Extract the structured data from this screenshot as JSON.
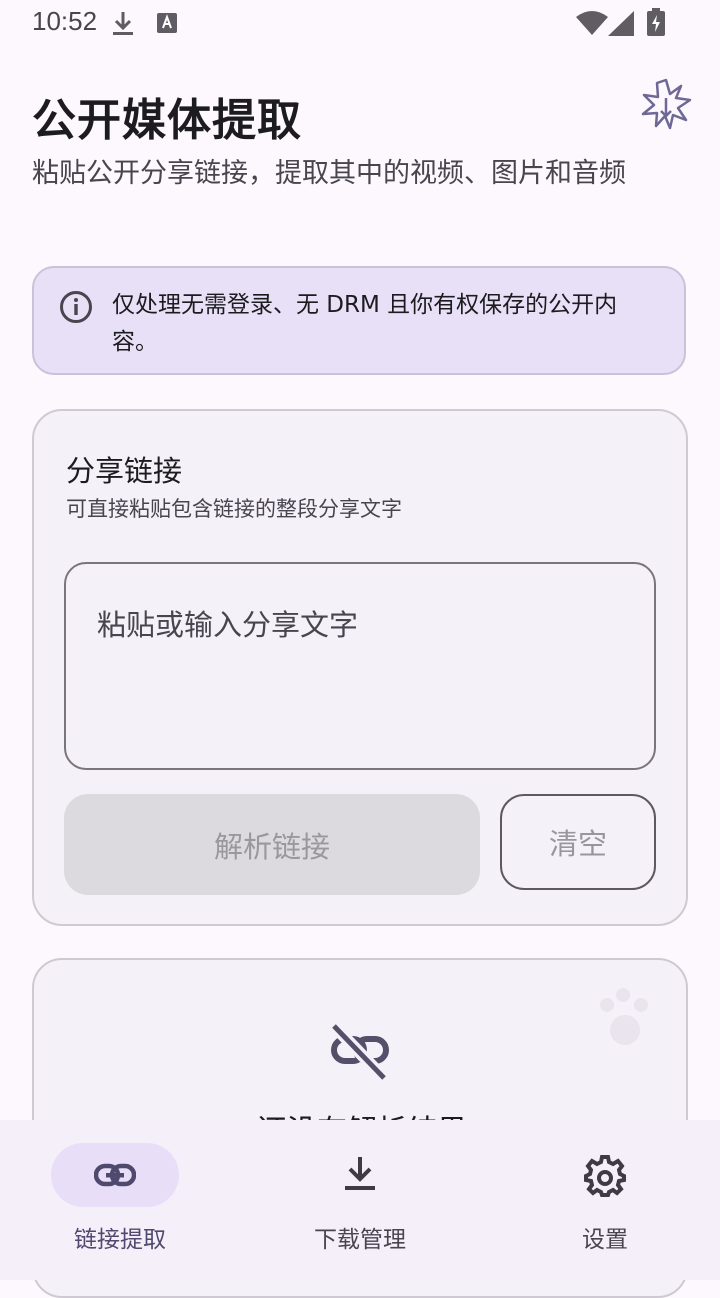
{
  "status_bar": {
    "time": "10:52"
  },
  "header": {
    "title": "公开媒体提取",
    "subtitle": "粘贴公开分享链接，提取其中的视频、图片和音频"
  },
  "notice": {
    "icon": "info-icon",
    "text": "仅处理无需登录、无 DRM 且你有权保存的公开内容。"
  },
  "share_card": {
    "title": "分享链接",
    "hint": "可直接粘贴包含链接的整段分享文字",
    "input": {
      "value": "",
      "placeholder": "粘贴或输入分享文字"
    },
    "parse_button": "解析链接",
    "clear_button": "清空"
  },
  "result_card": {
    "icon": "link-off-icon",
    "empty_text": "还没有解析结果"
  },
  "bottom_nav": {
    "items": [
      {
        "label": "链接提取",
        "icon": "link-icon",
        "active": true
      },
      {
        "label": "下载管理",
        "icon": "download-icon",
        "active": false
      },
      {
        "label": "设置",
        "icon": "gear-icon",
        "active": false
      }
    ]
  },
  "colors": {
    "background": "#fcf8fd",
    "primary": "#4f4a6d",
    "notice_bg": "#e7e0f6",
    "card_bg": "#f5f1f8",
    "nav_active_pill": "#e8def8"
  }
}
